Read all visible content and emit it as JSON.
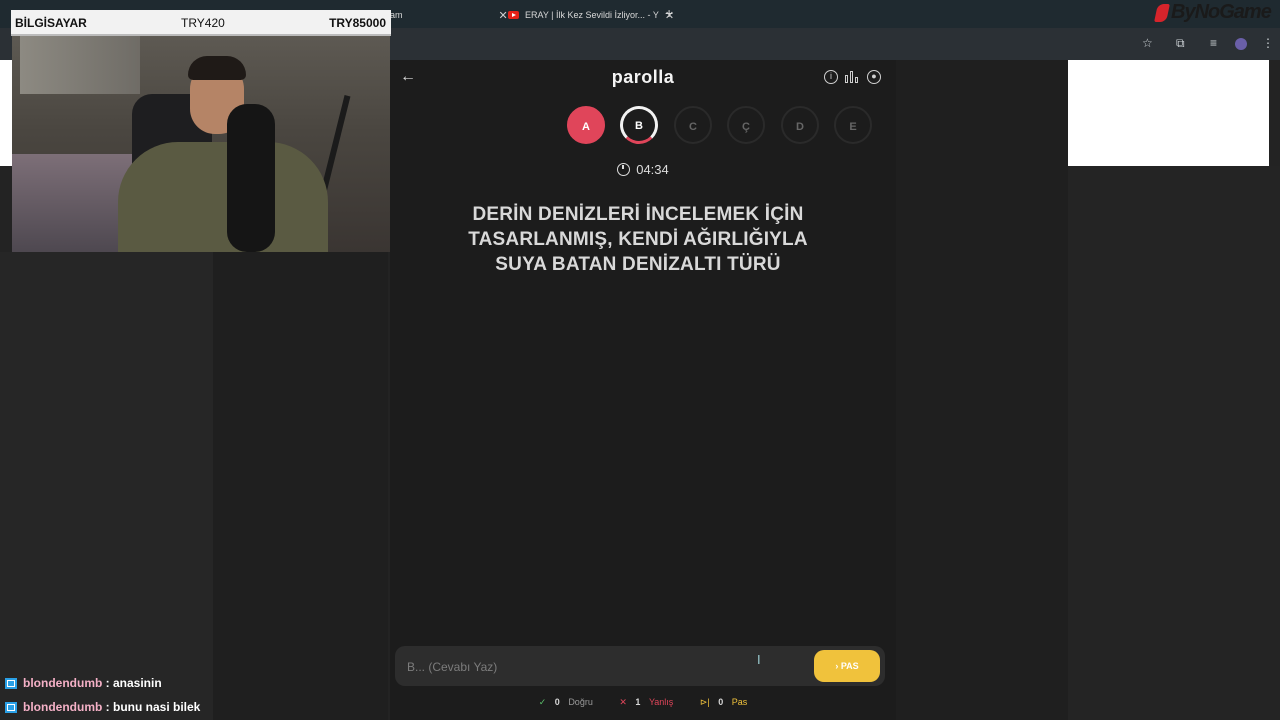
{
  "browser": {
    "tabs": [
      {
        "label": "am"
      },
      {
        "label": "ERAY | İlk Kez Sevildi İzliyor... - Y"
      }
    ],
    "new_tab_symbol": "+",
    "brand": "ByNoGame"
  },
  "stream_ticker": {
    "name": "BİLGİSAYAR",
    "price": "TRY420",
    "target": "TRY85000"
  },
  "game": {
    "logo": "parolla",
    "letters": [
      {
        "letter": "A",
        "state": "wrong"
      },
      {
        "letter": "B",
        "state": "current"
      },
      {
        "letter": "C",
        "state": "pending"
      },
      {
        "letter": "Ç",
        "state": "pending"
      },
      {
        "letter": "D",
        "state": "pending"
      },
      {
        "letter": "E",
        "state": "pending"
      }
    ],
    "timer": "04:34",
    "question": "DERİN DENİZLERİ İNCELEMEK İÇİN TASARLANMIŞ, KENDİ AĞIRLIĞIYLA SUYA BATAN DENİZALTI TÜRÜ",
    "answer_placeholder": "B... (Cevabı Yaz)",
    "answer_value": "",
    "pass_label": "PAS",
    "stats": {
      "correct_count": "0",
      "correct_label": "Doğru",
      "wrong_count": "1",
      "wrong_label": "Yanlış",
      "pass_count": "0",
      "pass_label": "Pas"
    }
  },
  "chat": [
    {
      "user": "blondendumb",
      "message": "anasinin"
    },
    {
      "user": "blondendumb",
      "message": "bunu nasi bilek"
    }
  ],
  "colors": {
    "accent_wrong": "#e0455a",
    "accent_pass": "#f0c23c",
    "accent_correct": "#5bbf6a",
    "panel_bg": "#1c1c1c"
  }
}
